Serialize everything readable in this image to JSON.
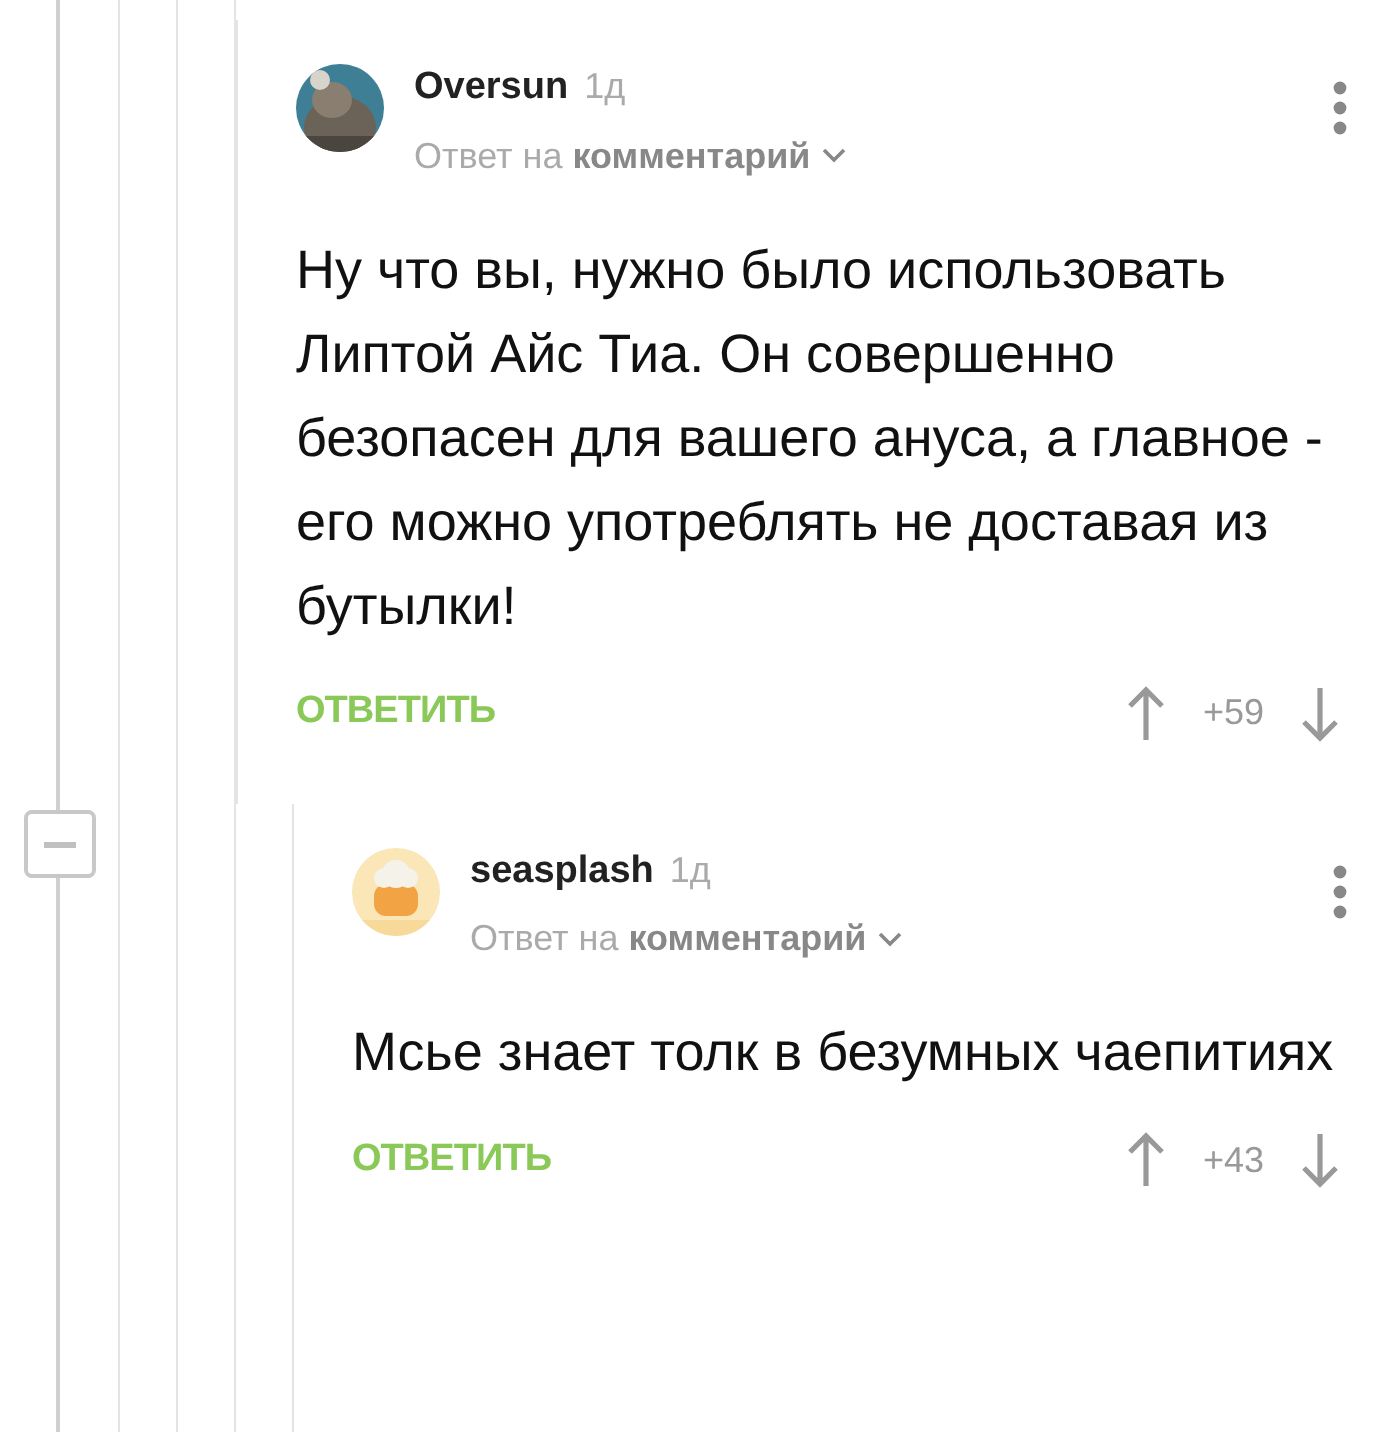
{
  "comments": [
    {
      "author": "Oversun",
      "time": "1д",
      "reply_prefix": "Ответ на",
      "reply_target": "комментарий",
      "text": "Ну что вы, нужно было использовать Липтой Айс Тиа. Он совершенно безопасен для вашего ануса, а главное - его можно употреблять не доставая из бутылки!",
      "reply_label": "ОТВЕТИТЬ",
      "rating": "+59"
    },
    {
      "author": "seasplash",
      "time": "1д",
      "reply_prefix": "Ответ на",
      "reply_target": "комментарий",
      "text": "Мсье знает толк в безумных чаепитиях",
      "reply_label": "ОТВЕТИТЬ",
      "rating": "+43"
    }
  ]
}
